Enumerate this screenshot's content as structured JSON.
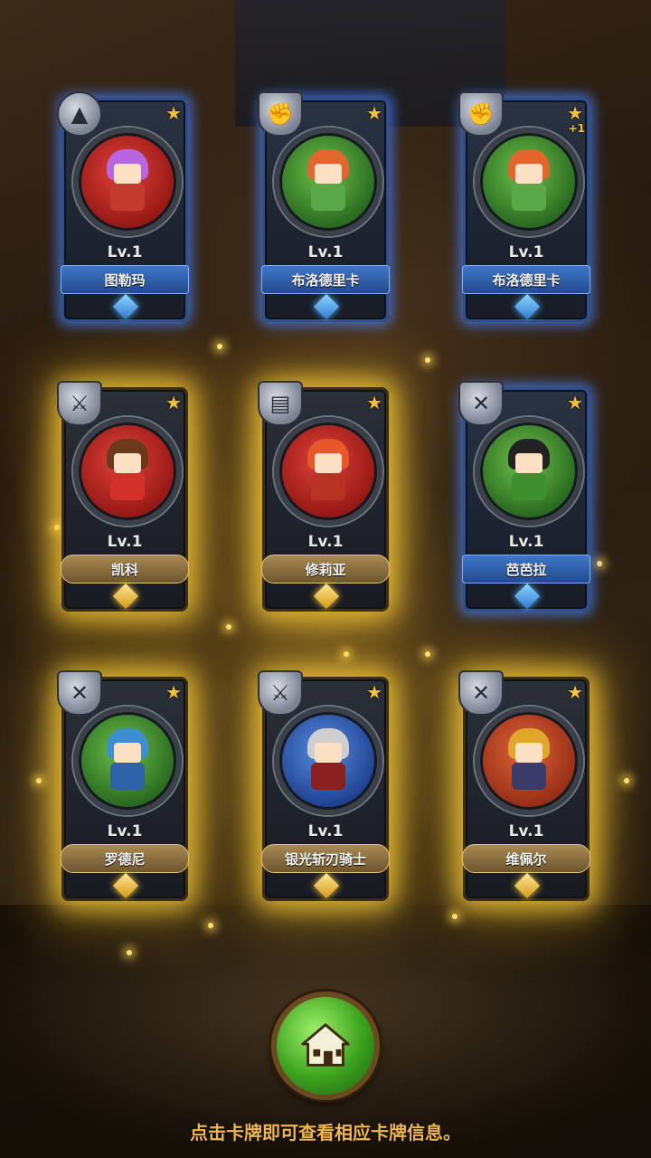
{
  "cards": [
    {
      "name": "图勒玛",
      "level": "Lv.1",
      "frame": "blue",
      "class_icon": "witch-hat-icon",
      "portrait": "red",
      "hair": "#b865e0",
      "outfit": "#c33b2e",
      "plus": ""
    },
    {
      "name": "布洛德里卡",
      "level": "Lv.1",
      "frame": "blue",
      "class_icon": "fist-icon",
      "portrait": "green",
      "hair": "#e0662e",
      "outfit": "#5aa84a",
      "plus": ""
    },
    {
      "name": "布洛德里卡",
      "level": "Lv.1",
      "frame": "blue",
      "class_icon": "fist-icon",
      "portrait": "green",
      "hair": "#e0662e",
      "outfit": "#5aa84a",
      "plus": "+1"
    },
    {
      "name": "凯科",
      "level": "Lv.1",
      "frame": "gold",
      "class_icon": "axe-icon",
      "portrait": "red",
      "hair": "#6a3a1a",
      "outfit": "#d2302a",
      "plus": ""
    },
    {
      "name": "修莉亚",
      "level": "Lv.1",
      "frame": "gold",
      "class_icon": "book-icon",
      "portrait": "red",
      "hair": "#e6572a",
      "outfit": "#b83324",
      "plus": ""
    },
    {
      "name": "芭芭拉",
      "level": "Lv.1",
      "frame": "blue",
      "class_icon": "crossed-swords-icon",
      "portrait": "green",
      "hair": "#222222",
      "outfit": "#3f8e2f",
      "plus": ""
    },
    {
      "name": "罗德尼",
      "level": "Lv.1",
      "frame": "gold",
      "class_icon": "crossed-swords-icon",
      "portrait": "green",
      "hair": "#3d8fd0",
      "outfit": "#2f62a8",
      "plus": ""
    },
    {
      "name": "银光斩刃骑士",
      "level": "Lv.1",
      "frame": "gold",
      "class_icon": "axe-icon",
      "portrait": "blue",
      "hair": "#cfcfcf",
      "outfit": "#8a2020",
      "plus": ""
    },
    {
      "name": "维佩尔",
      "level": "Lv.1",
      "frame": "gold",
      "class_icon": "crossed-swords-icon",
      "portrait": "orange",
      "hair": "#e0a82a",
      "outfit": "#3b3b6a",
      "plus": ""
    }
  ],
  "home_button": {
    "icon": "home-icon"
  },
  "hint_text": "点击卡牌即可查看相应卡牌信息。",
  "colors": {
    "blue_glow": "#4682ff",
    "gold_glow": "#ffd23c",
    "hint": "#f0b64e",
    "button_green": "#3ca11e"
  }
}
